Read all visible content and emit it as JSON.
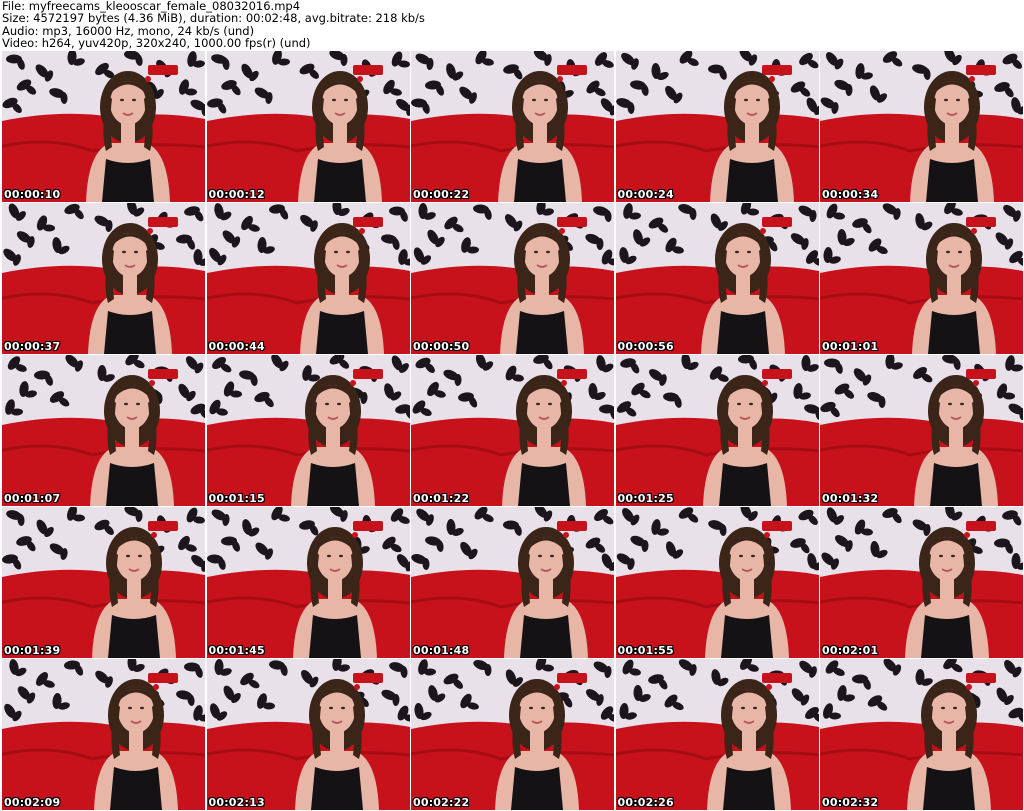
{
  "header": {
    "file_line": "File: myfreecams_kleooscar_female_08032016.mp4",
    "size_line": "Size: 4572197 bytes (4.36 MiB), duration: 00:02:48, avg.bitrate: 218 kb/s",
    "audio_line": "Audio: mp3, 16000 Hz, mono, 24 kb/s (und)",
    "video_line": "Video: h264, yuv420p, 320x240, 1000.00 fps(r) (und)"
  },
  "thumbnails": [
    {
      "timestamp": "00:00:10"
    },
    {
      "timestamp": "00:00:12"
    },
    {
      "timestamp": "00:00:22"
    },
    {
      "timestamp": "00:00:24"
    },
    {
      "timestamp": "00:00:34"
    },
    {
      "timestamp": "00:00:37"
    },
    {
      "timestamp": "00:00:44"
    },
    {
      "timestamp": "00:00:50"
    },
    {
      "timestamp": "00:00:56"
    },
    {
      "timestamp": "00:01:01"
    },
    {
      "timestamp": "00:01:07"
    },
    {
      "timestamp": "00:01:15"
    },
    {
      "timestamp": "00:01:22"
    },
    {
      "timestamp": "00:01:25"
    },
    {
      "timestamp": "00:01:32"
    },
    {
      "timestamp": "00:01:39"
    },
    {
      "timestamp": "00:01:45"
    },
    {
      "timestamp": "00:01:48"
    },
    {
      "timestamp": "00:01:55"
    },
    {
      "timestamp": "00:02:01"
    },
    {
      "timestamp": "00:02:09"
    },
    {
      "timestamp": "00:02:13"
    },
    {
      "timestamp": "00:02:22"
    },
    {
      "timestamp": "00:02:26"
    },
    {
      "timestamp": "00:02:32"
    }
  ],
  "colors": {
    "wallpaper": "#e9e1ea",
    "leaf_pattern": "#1b161b",
    "red_cloth": "#c8121b",
    "hair": "#3b2418",
    "skin": "#e7b6a6",
    "top": "#141214"
  }
}
